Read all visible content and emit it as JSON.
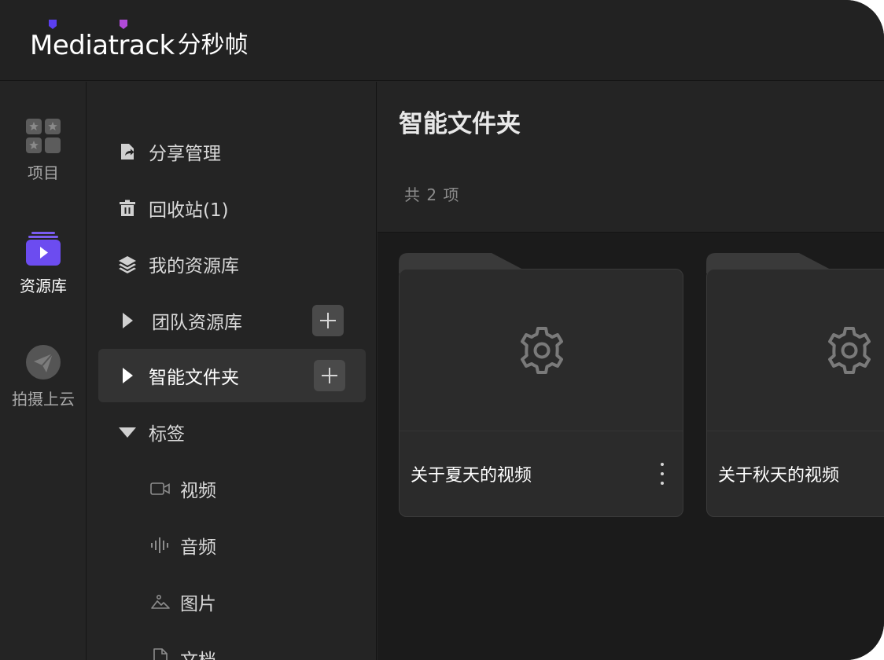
{
  "header": {
    "logo_text": "Mediatrack",
    "logo_cn": "分秒帧"
  },
  "rail": {
    "items": [
      {
        "label": "项目",
        "icon": "grid-icon"
      },
      {
        "label": "资源库",
        "icon": "media-library-icon",
        "active": true
      },
      {
        "label": "拍摄上云",
        "icon": "send-icon"
      }
    ]
  },
  "tree": {
    "items": [
      {
        "label": "分享管理",
        "icon": "share-file-icon"
      },
      {
        "label": "回收站(1)",
        "icon": "trash-icon"
      },
      {
        "label": "我的资源库",
        "icon": "layers-icon"
      },
      {
        "label": "团队资源库",
        "icon": "caret-right-icon",
        "has_add": true
      },
      {
        "label": "智能文件夹",
        "icon": "caret-right-icon",
        "has_add": true,
        "selected": true
      },
      {
        "label": "标签",
        "icon": "caret-down-icon"
      }
    ],
    "tags": [
      {
        "label": "视频",
        "icon": "video-icon"
      },
      {
        "label": "音频",
        "icon": "audio-wave-icon"
      },
      {
        "label": "图片",
        "icon": "image-icon"
      },
      {
        "label": "文档",
        "icon": "document-icon"
      }
    ]
  },
  "main": {
    "title": "智能文件夹",
    "count_text": "共 2 项",
    "folders": [
      {
        "name": "关于夏天的视频",
        "icon": "gear-icon"
      },
      {
        "name": "关于秋天的视频",
        "icon": "gear-icon"
      }
    ]
  },
  "colors": {
    "accent": "#6c4cf0",
    "logo_mark_1": "#5b3ff0",
    "logo_mark_2": "#b14ad8",
    "background": "#242424",
    "content_background": "#1b1b1b"
  }
}
